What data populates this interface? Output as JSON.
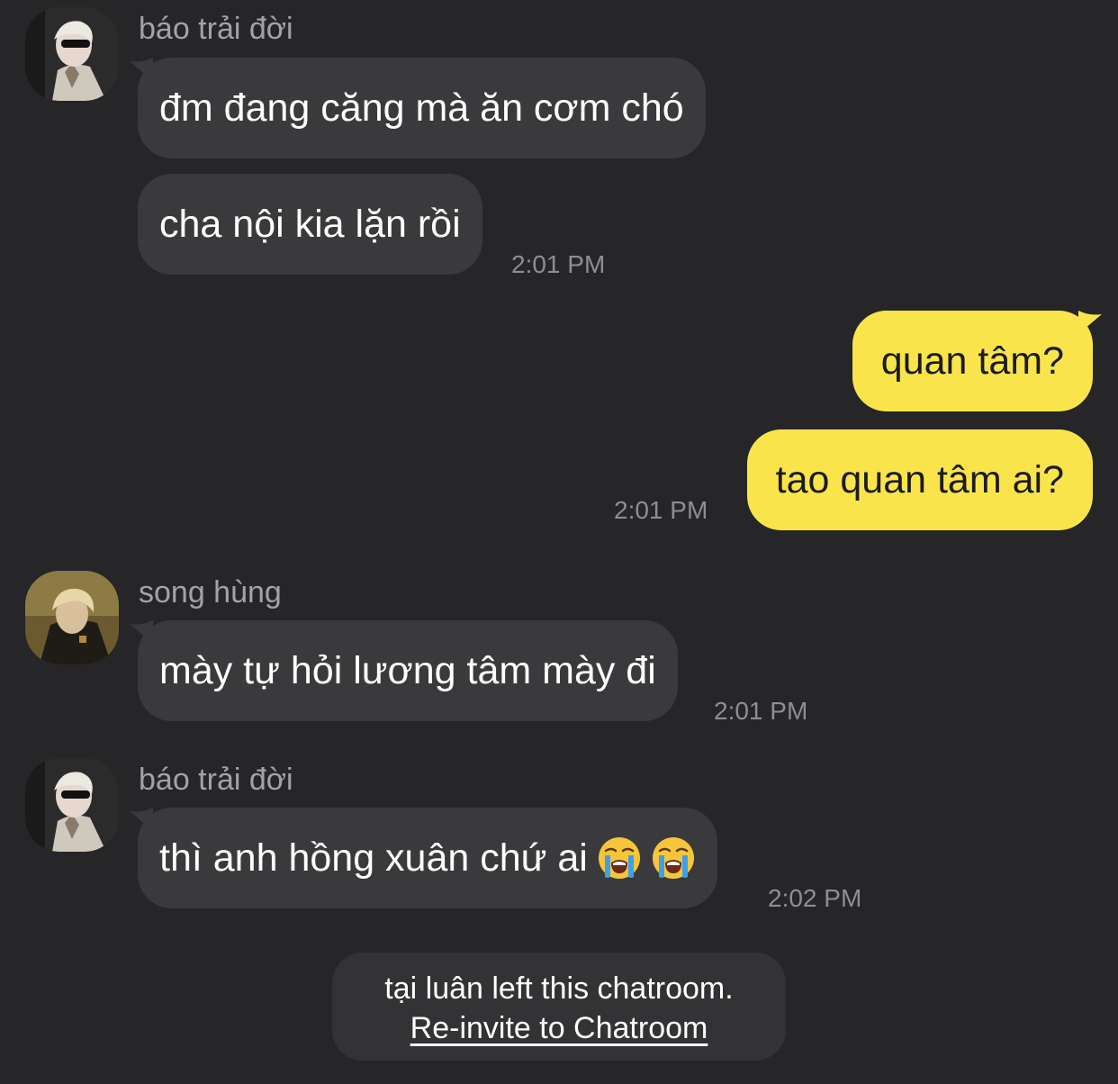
{
  "messages": [
    {
      "sender": "báo trải đời",
      "lines": [
        "đm đang căng mà ăn cơm chó",
        "cha nội kia lặn rồi"
      ],
      "time": "2:01 PM"
    },
    {
      "lines": [
        "quan tâm?",
        "tao quan tâm ai?"
      ],
      "time": "2:01 PM"
    },
    {
      "sender": "song hùng",
      "lines": [
        "mày tự hỏi lương tâm mày đi"
      ],
      "time": "2:01 PM"
    },
    {
      "sender": "báo trải đời",
      "lines": [
        "thì anh hồng xuân chứ ai"
      ],
      "time": "2:02 PM"
    }
  ],
  "notice": {
    "text": "tại luân left this chatroom.",
    "link": "Re-invite to Chatroom"
  },
  "colors": {
    "background": "#262628",
    "incoming_bubble": "#3a3a3c",
    "outgoing_bubble": "#f9e54b",
    "sender_name": "#a3a3a6",
    "timestamp": "#8e8e92"
  },
  "icons": {
    "emoji": "loudly-crying-face-emoji"
  }
}
